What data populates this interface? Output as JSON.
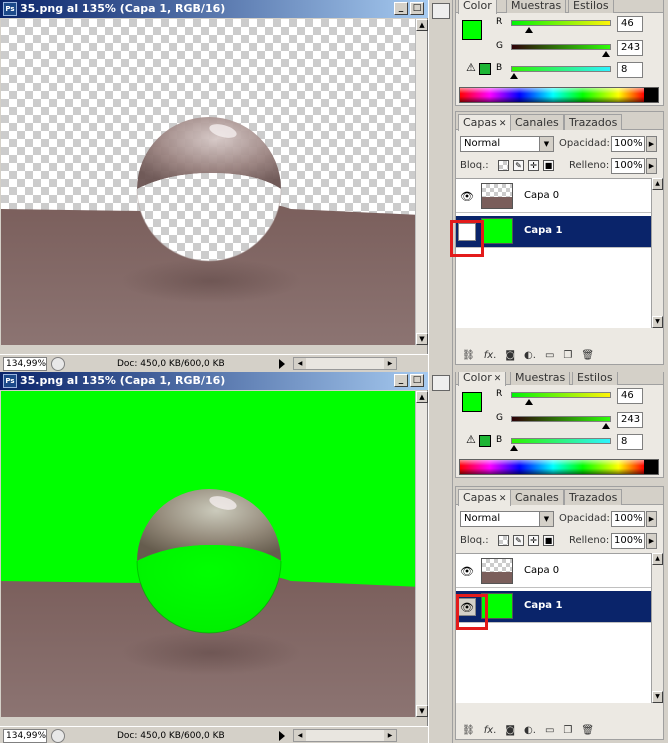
{
  "top": {
    "title": "35.png al 135% (Capa 1, RGB/16)",
    "status": {
      "zoom": "134,99%",
      "doc": "Doc: 450,0 KB/600,0 KB"
    },
    "color": {
      "tabs": [
        "Color",
        "Muestras",
        "Estilos"
      ],
      "r": {
        "label": "R",
        "value": "46",
        "level": 0.18
      },
      "g": {
        "label": "G",
        "value": "243",
        "level": 0.95
      },
      "b": {
        "label": "B",
        "value": "8",
        "level": 0.03
      }
    },
    "layers": {
      "tabs": [
        "Capas",
        "Canales",
        "Trazados"
      ],
      "blend_mode": "Normal",
      "opacity_label": "Opacidad:",
      "opacity": "100%",
      "lock_label": "Bloq.:",
      "fill_label": "Relleno:",
      "fill": "100%",
      "items": [
        {
          "name": "Capa 0",
          "visible": true,
          "selected": false
        },
        {
          "name": "Capa 1",
          "visible": false,
          "selected": true
        }
      ]
    }
  },
  "bottom": {
    "title": "35.png al 135% (Capa 1, RGB/16)",
    "status": {
      "zoom": "134,99%",
      "doc": "Doc: 450,0 KB/600,0 KB"
    },
    "color": {
      "tabs": [
        "Color",
        "Muestras",
        "Estilos"
      ],
      "r": {
        "label": "R",
        "value": "46",
        "level": 0.18
      },
      "g": {
        "label": "G",
        "value": "243",
        "level": 0.95
      },
      "b": {
        "label": "B",
        "value": "8",
        "level": 0.03
      }
    },
    "layers": {
      "tabs": [
        "Capas",
        "Canales",
        "Trazados"
      ],
      "blend_mode": "Normal",
      "opacity_label": "Opacidad:",
      "opacity": "100%",
      "lock_label": "Bloq.:",
      "fill_label": "Relleno:",
      "fill": "100%",
      "items": [
        {
          "name": "Capa 0",
          "visible": true,
          "selected": false
        },
        {
          "name": "Capa 1",
          "visible": true,
          "selected": true
        }
      ]
    }
  },
  "colors": {
    "fill_green": "#00ff00",
    "selection": "#0a246a",
    "highlight": "#e31b1b"
  },
  "icons": [
    "photoshop-doc-icon",
    "minimize-icon",
    "maximize-icon",
    "eye-icon",
    "link-icon",
    "fx-icon",
    "mask-icon",
    "adjustment-icon",
    "folder-icon",
    "new-layer-icon",
    "trash-icon",
    "warning-icon",
    "lock-icon",
    "move-icon",
    "brush-icon",
    "transparency-lock-icon"
  ]
}
